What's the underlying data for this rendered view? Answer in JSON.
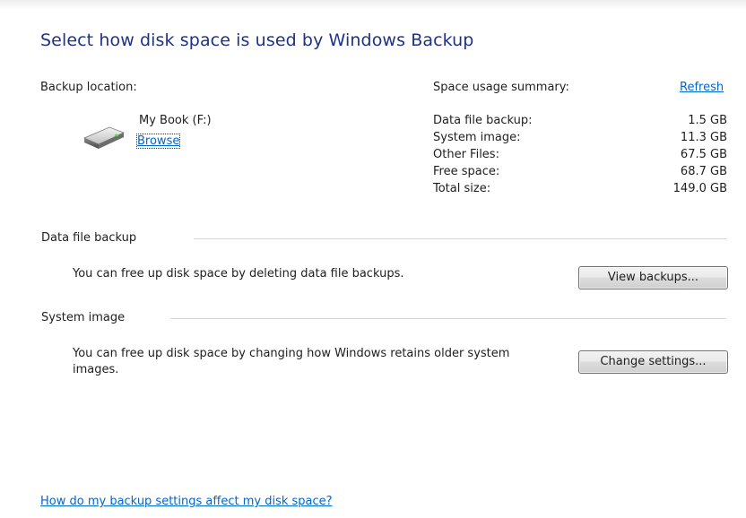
{
  "title": "Select how disk space is used by Windows Backup",
  "backup_location": {
    "label": "Backup location:",
    "drive_name": "My Book (F:)",
    "browse_link": "Browse",
    "icon": "hard-drive-icon"
  },
  "summary": {
    "label": "Space usage summary:",
    "refresh_link": "Refresh",
    "rows": [
      {
        "key": "Data file backup:",
        "value": "1.5 GB"
      },
      {
        "key": "System image:",
        "value": "11.3 GB"
      },
      {
        "key": "Other Files:",
        "value": "67.5 GB"
      },
      {
        "key": "Free space:",
        "value": "68.7 GB"
      },
      {
        "key": "Total size:",
        "value": "149.0 GB"
      }
    ]
  },
  "data_file_backup": {
    "heading": "Data file backup",
    "description": "You can free up disk space by deleting data file backups.",
    "button": "View backups..."
  },
  "system_image": {
    "heading": "System image",
    "description": "You can free up disk space by changing how Windows retains older system images.",
    "button": "Change settings..."
  },
  "help_link": "How do my backup settings affect my disk space?",
  "colors": {
    "title": "#1e3287",
    "link": "#0066cc",
    "divider": "#d5d5d5"
  }
}
